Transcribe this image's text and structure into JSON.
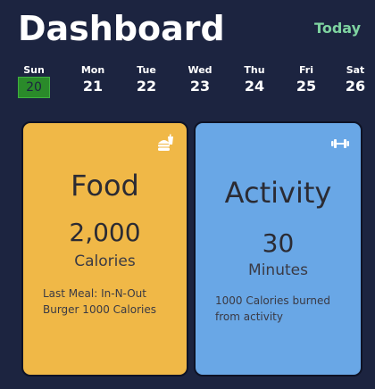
{
  "header": {
    "title": "Dashboard",
    "today_label": "Today"
  },
  "week": {
    "days": [
      {
        "name": "Sun",
        "date": "20",
        "selected": true
      },
      {
        "name": "Mon",
        "date": "21",
        "selected": false
      },
      {
        "name": "Tue",
        "date": "22",
        "selected": false
      },
      {
        "name": "Wed",
        "date": "23",
        "selected": false
      },
      {
        "name": "Thu",
        "date": "24",
        "selected": false
      },
      {
        "name": "Fri",
        "date": "25",
        "selected": false
      },
      {
        "name": "Sat",
        "date": "26",
        "selected": false
      }
    ]
  },
  "cards": {
    "food": {
      "title": "Food",
      "value": "2,000",
      "unit": "Calories",
      "description": "Last Meal: In-N-Out Burger 1000 Calories",
      "icon": "food-icon",
      "color": "#f0b847"
    },
    "activity": {
      "title": "Activity",
      "value": "30",
      "unit": "Minutes",
      "description": "1000 Calories burned from activity",
      "icon": "dumbbell-icon",
      "color": "#69a7e6"
    }
  },
  "colors": {
    "background": "#1c2440",
    "today_accent": "#7ed3a0",
    "selected_day": "#2a8a2a"
  }
}
